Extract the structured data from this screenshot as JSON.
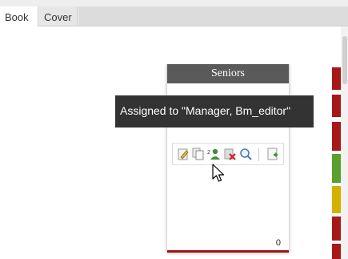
{
  "tabs": [
    {
      "label": "Book",
      "active": true
    },
    {
      "label": "Cover",
      "active": false
    }
  ],
  "card": {
    "title": "Seniors",
    "count": "0"
  },
  "tooltip": {
    "text": "Assigned to \"Manager, Bm_editor\""
  },
  "toolbar": {
    "icons": [
      "edit-icon",
      "copy-icon",
      "assign-user-icon",
      "delete-icon",
      "search-icon",
      "add-page-icon"
    ]
  },
  "status_strip": {
    "colors": [
      "#a81818",
      "#a81818",
      "#a81818",
      "#5aa02c",
      "#d4b000",
      "#a81818",
      "#a81818"
    ]
  }
}
